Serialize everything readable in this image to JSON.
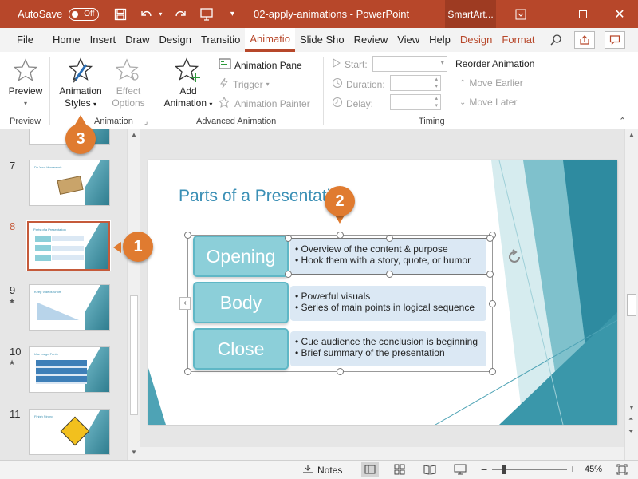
{
  "titlebar": {
    "autosave_label": "AutoSave",
    "autosave_state": "Off",
    "document_title": "02-apply-animations  -  PowerPoint",
    "context_tab": "SmartArt...",
    "icons": [
      "save-icon",
      "undo-icon",
      "redo-icon",
      "present-icon",
      "customize-icon"
    ]
  },
  "tabs": [
    "File",
    "Home",
    "Insert",
    "Draw",
    "Design",
    "Transitio",
    "Animatio",
    "Slide Sho",
    "Review",
    "View",
    "Help",
    "Design",
    "Format"
  ],
  "active_tab_index": 6,
  "ribbon": {
    "preview": {
      "button": "Preview",
      "group": "Preview"
    },
    "animation": {
      "styles_line1": "Animation",
      "styles_line2": "Styles",
      "effect_line1": "Effect",
      "effect_line2": "Options",
      "group": "Animation"
    },
    "advanced": {
      "add_line1": "Add",
      "add_line2": "Animation",
      "pane": "Animation Pane",
      "trigger": "Trigger",
      "painter": "Animation Painter",
      "group": "Advanced Animation"
    },
    "timing": {
      "start": "Start:",
      "duration": "Duration:",
      "delay": "Delay:",
      "reorder": "Reorder Animation",
      "earlier": "Move Earlier",
      "later": "Move Later",
      "group": "Timing"
    }
  },
  "thumbnails": [
    {
      "num": "7",
      "title": "Do Your Homework",
      "star": ""
    },
    {
      "num": "8",
      "title": "Parts of a Presentation",
      "star": ""
    },
    {
      "num": "9",
      "title": "Keep Videos Short",
      "star": "★"
    },
    {
      "num": "10",
      "title": "Use Large Fonts",
      "star": "★"
    },
    {
      "num": "11",
      "title": "Finish Strong",
      "star": ""
    }
  ],
  "slide": {
    "title": "Parts of a Presentation",
    "rows": [
      {
        "label": "Opening",
        "bullet1": "• Overview of the content & purpose",
        "bullet2": "• Hook them with a story, quote, or humor"
      },
      {
        "label": "Body",
        "bullet1": "• Powerful visuals",
        "bullet2": "• Series of main points in logical sequence"
      },
      {
        "label": "Close",
        "bullet1": "• Cue audience the conclusion is beginning",
        "bullet2": "• Brief summary of the presentation"
      }
    ]
  },
  "statusbar": {
    "notes": "Notes",
    "zoom": "45%"
  },
  "callouts": [
    "1",
    "2",
    "3"
  ],
  "colors": {
    "accent": "#b7472a",
    "callout": "#e07b30",
    "teal": "#3a8fb5"
  }
}
